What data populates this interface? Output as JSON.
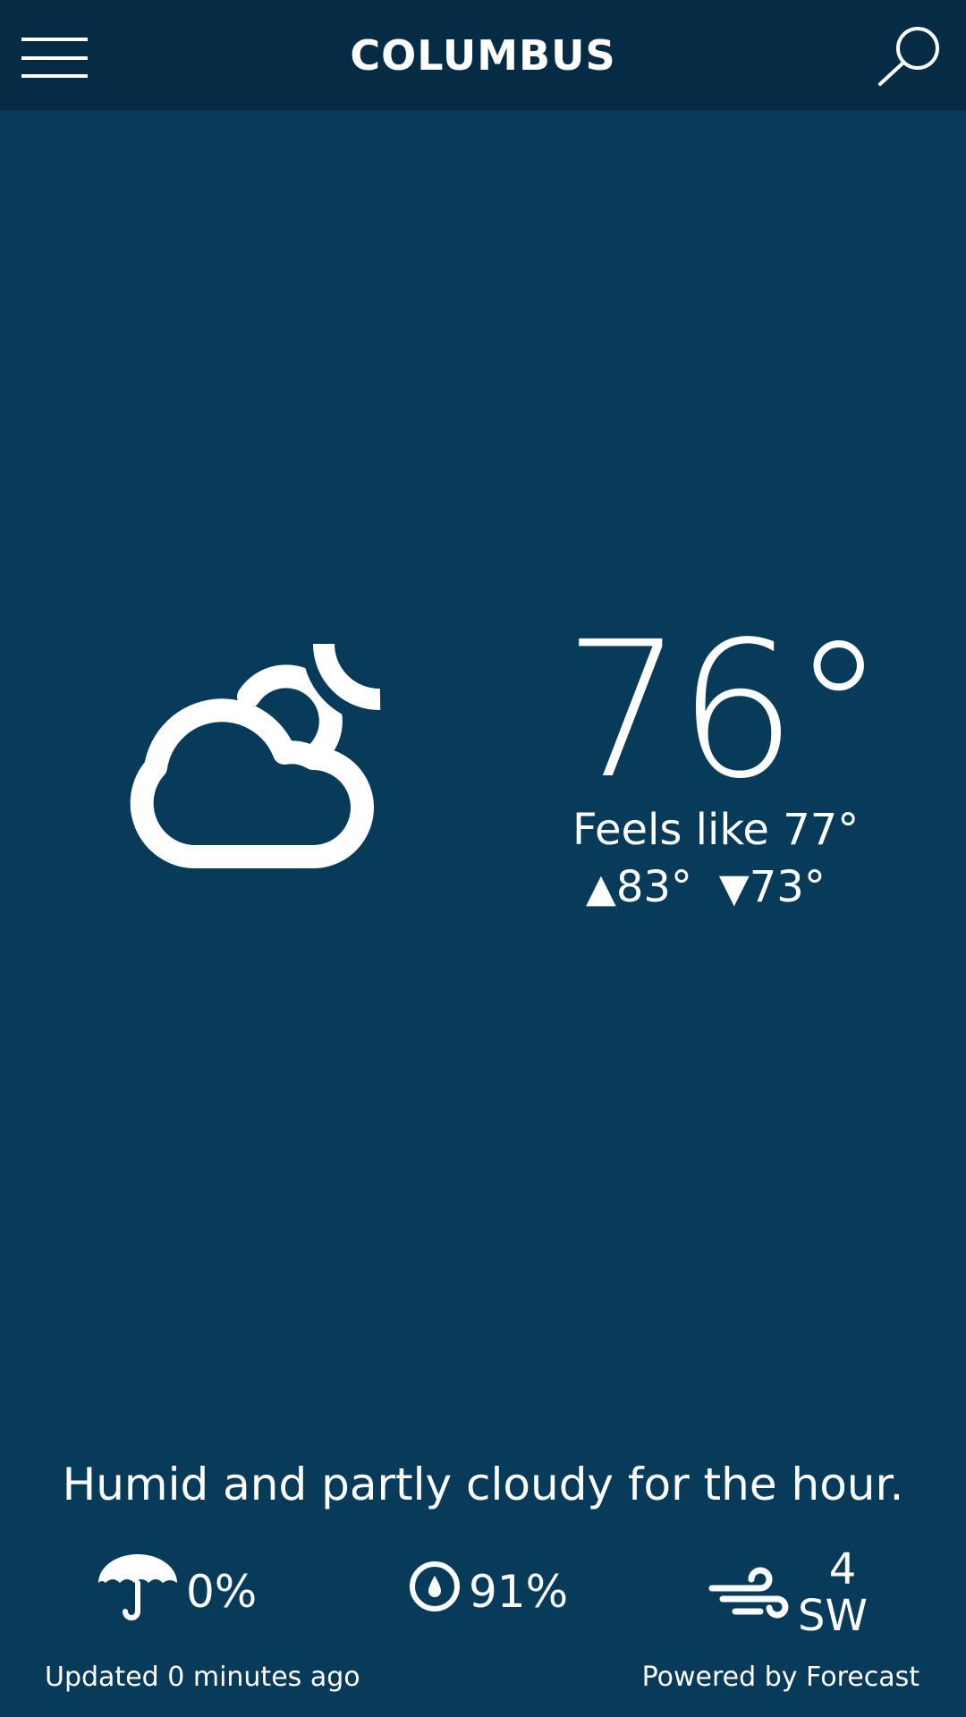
{
  "header": {
    "title": "COLUMBUS",
    "menu_icon": "hamburger-icon",
    "search_icon": "search-icon"
  },
  "current": {
    "condition_icon": "partly-cloudy-night-icon",
    "temperature": "76°",
    "feels_like": "Feels like 77°",
    "high": "83°",
    "low": "73°",
    "high_arrow": "▲",
    "low_arrow": "▼"
  },
  "summary": "Humid and partly cloudy for the hour.",
  "stats": {
    "precipitation": {
      "icon": "umbrella-icon",
      "value": "0%"
    },
    "humidity": {
      "icon": "humidity-drop-icon",
      "value": "91%"
    },
    "wind": {
      "icon": "wind-icon",
      "speed": "4",
      "direction": "SW"
    }
  },
  "footer": {
    "updated": "Updated 0 minutes ago",
    "powered_by": "Powered by Forecast"
  },
  "colors": {
    "background": "#083b5a",
    "header": "#062c45",
    "foreground": "#ffffff"
  }
}
